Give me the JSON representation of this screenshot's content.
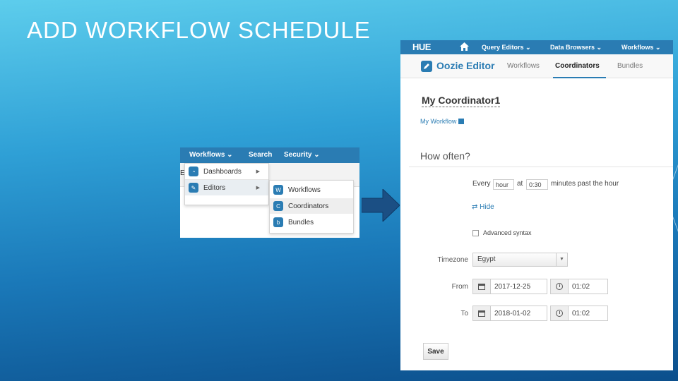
{
  "slide": {
    "title": "ADD WORKFLOW SCHEDULE"
  },
  "menu_screenshot": {
    "topbar": [
      "Workflows ⌄",
      "Search",
      "Security ⌄"
    ],
    "edge_letter": "E",
    "level1": [
      {
        "label": "Dashboards",
        "icon": "dashboard-icon"
      },
      {
        "label": "Editors",
        "icon": "pencil-icon"
      }
    ],
    "level2": [
      {
        "label": "Workflows",
        "icon": "W"
      },
      {
        "label": "Coordinators",
        "icon": "C"
      },
      {
        "label": "Bundles",
        "icon": "b"
      }
    ]
  },
  "hue": {
    "logo": "HUE",
    "topnav": [
      "Query Editors ⌄",
      "Data Browsers ⌄",
      "Workflows ⌄"
    ],
    "app_title": "Oozie Editor",
    "subtabs": [
      "Workflows",
      "Coordinators",
      "Bundles"
    ],
    "active_subtab": "Coordinators",
    "coordinator_name": "My Coordinator1",
    "workflow_link": "My Workflow",
    "how_often": "How often?",
    "frequency": {
      "every_label": "Every",
      "unit_value": "hour",
      "at_label": "at",
      "time_value": "0:30",
      "suffix": "minutes past the hour"
    },
    "hide_link": "⇄ Hide",
    "advanced_syntax": "Advanced syntax",
    "timezone": {
      "label": "Timezone",
      "value": "Egypt"
    },
    "from": {
      "label": "From",
      "date": "2017-12-25",
      "time": "01:02"
    },
    "to": {
      "label": "To",
      "date": "2018-01-02",
      "time": "01:02"
    },
    "save_label": "Save"
  },
  "colors": {
    "hue_blue": "#2a7cb3",
    "arrow": "#1b4f84"
  }
}
